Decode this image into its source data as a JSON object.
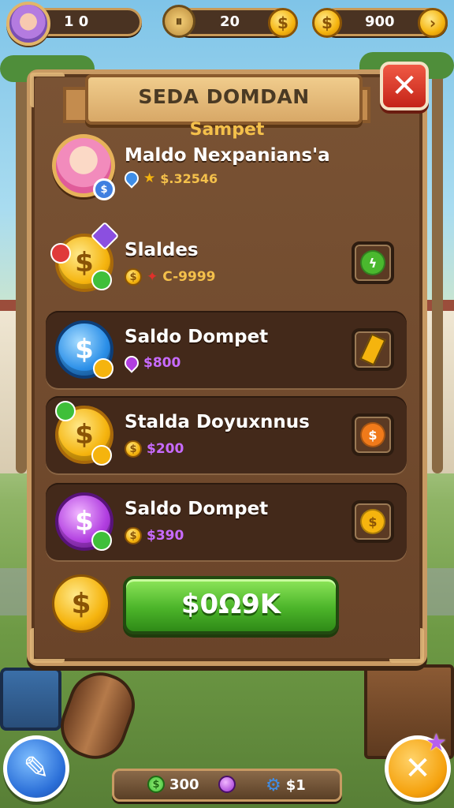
{
  "top_bar": {
    "level": "1 0",
    "currency_1": "20",
    "currency_2": "900"
  },
  "dialog": {
    "title": "SEDA DOMDAN",
    "subtitle": "Sampet",
    "profile": {
      "name": "Maldo Nexpanians'a",
      "stat": "$.32546"
    },
    "rows": [
      {
        "title": "Slaldes",
        "value": "C-9999",
        "icon": "coin-pile-icon",
        "accent": "#f4c04b"
      },
      {
        "title": "Saldo Dompet",
        "value": "$800",
        "icon": "blue-dollar-coin-icon",
        "accent": "#c86bff"
      },
      {
        "title": "Stalda Doyuxnnus",
        "value": "$200",
        "icon": "gold-dollar-coin-icon",
        "accent": "#c86bff"
      },
      {
        "title": "Saldo Dompet",
        "value": "$390",
        "icon": "purple-dollar-coin-icon",
        "accent": "#c86bff"
      }
    ],
    "buy_button": "$0Ω9K"
  },
  "bottom_bar": {
    "cash": "300",
    "gems": "$1"
  },
  "colors": {
    "panel": "#6a4429",
    "gold": "#f4c04b",
    "green_button": "#4cb52a",
    "close_red": "#c42418"
  }
}
